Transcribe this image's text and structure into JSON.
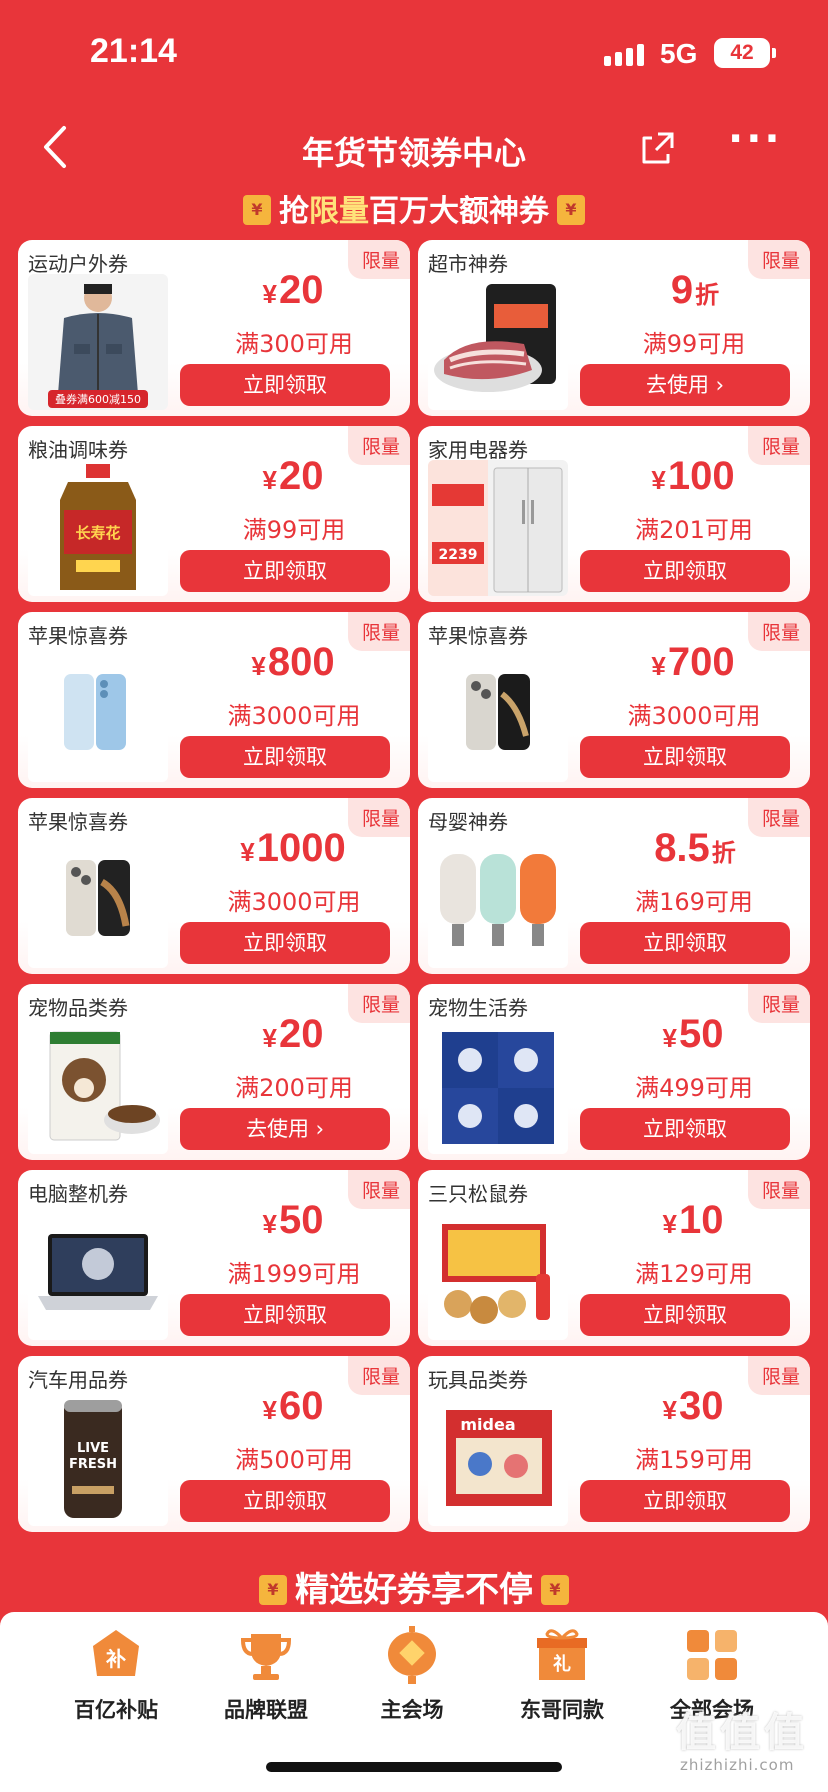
{
  "status": {
    "time": "21:14",
    "network": "5G",
    "battery": "42"
  },
  "nav": {
    "back_icon": "chevron-left-icon",
    "title": "年货节领券中心",
    "share_icon": "share-icon",
    "more": "···"
  },
  "banner": {
    "prefix": "抢",
    "highlight": "限量",
    "suffix": "百万大额神券"
  },
  "coupons": [
    {
      "name": "运动户外券",
      "badge": "限量",
      "yen": "¥",
      "amount": "20",
      "unit": "",
      "condition": "满300可用",
      "button": "立即领取",
      "image": "jacket-man",
      "image_text": "叠券满600减150"
    },
    {
      "name": "超市神券",
      "badge": "限量",
      "yen": "",
      "amount": "9",
      "unit": "折",
      "condition": "满99可用",
      "button": "去使用 ›",
      "image": "pork-meat",
      "image_text": ""
    },
    {
      "name": "粮油调味券",
      "badge": "限量",
      "yen": "¥",
      "amount": "20",
      "unit": "",
      "condition": "满99可用",
      "button": "立即领取",
      "image": "oil-bottle",
      "image_text": "长寿花"
    },
    {
      "name": "家用电器券",
      "badge": "限量",
      "yen": "¥",
      "amount": "100",
      "unit": "",
      "condition": "满201可用",
      "button": "立即领取",
      "image": "fridge",
      "image_text": "2239"
    },
    {
      "name": "苹果惊喜券",
      "badge": "限量",
      "yen": "¥",
      "amount": "800",
      "unit": "",
      "condition": "满3000可用",
      "button": "立即领取",
      "image": "iphone-blue",
      "image_text": ""
    },
    {
      "name": "苹果惊喜券",
      "badge": "限量",
      "yen": "¥",
      "amount": "700",
      "unit": "",
      "condition": "满3000可用",
      "button": "立即领取",
      "image": "iphone-pro",
      "image_text": ""
    },
    {
      "name": "苹果惊喜券",
      "badge": "限量",
      "yen": "¥",
      "amount": "1000",
      "unit": "",
      "condition": "满3000可用",
      "button": "立即领取",
      "image": "iphone-pro-max",
      "image_text": ""
    },
    {
      "name": "母婴神券",
      "badge": "限量",
      "yen": "",
      "amount": "8.5",
      "unit": "折",
      "condition": "满169可用",
      "button": "立即领取",
      "image": "nail-clippers",
      "image_text": ""
    },
    {
      "name": "宠物品类券",
      "badge": "限量",
      "yen": "¥",
      "amount": "20",
      "unit": "",
      "condition": "满200可用",
      "button": "去使用 ›",
      "image": "dog-food",
      "image_text": ""
    },
    {
      "name": "宠物生活券",
      "badge": "限量",
      "yen": "¥",
      "amount": "50",
      "unit": "",
      "condition": "满499可用",
      "button": "立即领取",
      "image": "cat-food-bags",
      "image_text": ""
    },
    {
      "name": "电脑整机券",
      "badge": "限量",
      "yen": "¥",
      "amount": "50",
      "unit": "",
      "condition": "满1999可用",
      "button": "立即领取",
      "image": "laptop",
      "image_text": ""
    },
    {
      "name": "三只松鼠券",
      "badge": "限量",
      "yen": "¥",
      "amount": "10",
      "unit": "",
      "condition": "满129可用",
      "button": "立即领取",
      "image": "snack-gift-box",
      "image_text": ""
    },
    {
      "name": "汽车用品券",
      "badge": "限量",
      "yen": "¥",
      "amount": "60",
      "unit": "",
      "condition": "满500可用",
      "button": "立即领取",
      "image": "can-drink",
      "image_text": "LIVE FRESH"
    },
    {
      "name": "玩具品类券",
      "badge": "限量",
      "yen": "¥",
      "amount": "30",
      "unit": "",
      "condition": "满159可用",
      "button": "立即领取",
      "image": "toy-gift-box",
      "image_text": "midea"
    }
  ],
  "section": {
    "title": "精选好券享不停"
  },
  "tabbar": [
    {
      "label": "百亿补贴",
      "icon": "subsidy-icon",
      "icon_text": "补"
    },
    {
      "label": "品牌联盟",
      "icon": "trophy-icon",
      "icon_text": ""
    },
    {
      "label": "主会场",
      "icon": "lantern-icon",
      "icon_text": ""
    },
    {
      "label": "东哥同款",
      "icon": "gift-icon",
      "icon_text": "礼"
    },
    {
      "label": "全部会场",
      "icon": "grid-icon",
      "icon_text": ""
    }
  ],
  "watermark": {
    "main": "值值值",
    "sub": "zhizhizhi.com"
  },
  "colors": {
    "primary": "#e8353a",
    "highlight": "#ffe27a",
    "badge_bg": "#fde3e1",
    "tab_icon": "#f08a3a"
  }
}
